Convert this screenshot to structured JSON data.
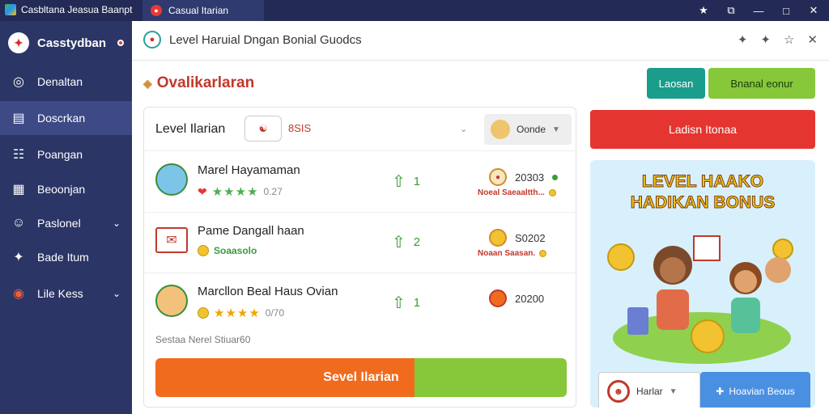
{
  "window": {
    "app_title": "Casbltana Jeasua Baanpt",
    "tab_label": "Casual Itarian",
    "controls": [
      "★",
      "⧉",
      "—",
      "□",
      "✕"
    ]
  },
  "sidebar": {
    "brand": "Casstydban",
    "items": [
      {
        "label": "Denaltan",
        "icon": "globe-icon",
        "glyph": "◎"
      },
      {
        "label": "Doscrkan",
        "icon": "briefcase-icon",
        "glyph": "▤"
      },
      {
        "label": "Poangan",
        "icon": "chart-icon",
        "glyph": "☷"
      },
      {
        "label": "Beoonjan",
        "icon": "book-icon",
        "glyph": "▦"
      },
      {
        "label": "Paslonel",
        "icon": "user-icon",
        "glyph": "☺"
      },
      {
        "label": "Bade Itum",
        "icon": "badge-icon",
        "glyph": "✦"
      },
      {
        "label": "Lile Kess",
        "icon": "record-icon",
        "glyph": "◉"
      }
    ]
  },
  "header": {
    "title": "Level Haruial Dngan Bonial Guodcs",
    "actions": [
      "✦",
      "✦",
      "☆",
      "✕"
    ]
  },
  "section": {
    "title": "Ovalikarlaran"
  },
  "buttons": {
    "teal": "Laosan",
    "green": "Bnanal eonur",
    "red": "Ladisn Itonaa"
  },
  "card": {
    "header_label": "Level Ilarian",
    "pill": "☯",
    "value": "8SIS",
    "select_label": "Oonde",
    "rows": [
      {
        "name": "Marel Hayamaman",
        "kind": "avatar",
        "meta_type": "stars",
        "meta_value": "0.27",
        "rank": "1",
        "score": "20303",
        "sub": "Noeal Saeaaltth..."
      },
      {
        "name": "Pame Dangall haan",
        "kind": "envelope",
        "meta_type": "coin",
        "meta_value": "Soaasolo",
        "rank": "2",
        "score": "S0202",
        "sub": "Noaan Saasan."
      },
      {
        "name": "Marcllon Beal Haus Ovian",
        "kind": "avatar",
        "meta_type": "gold",
        "meta_value": "0/70",
        "rank": "1",
        "score": "20200",
        "sub": ""
      }
    ],
    "footer": "Sestaa Nerel Stiuar60",
    "cta": "Sevel Ilarian"
  },
  "promo": {
    "title_line1": "LEVEL HAAKO",
    "title_line2": "HADIKAN BONUS",
    "select_label": "Harlar",
    "button_label": "Hoavian Beous"
  },
  "colors": {
    "sidebar": "#2b3566",
    "accent_red": "#e53530",
    "accent_orange": "#f06b1e",
    "accent_green": "#86c83a",
    "teal": "#1a9e8b"
  }
}
